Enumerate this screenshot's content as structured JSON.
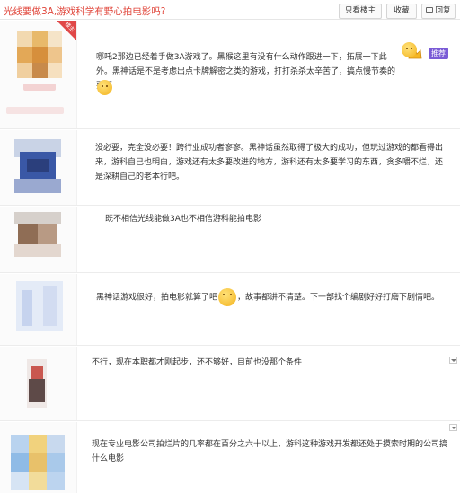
{
  "header": {
    "title": "光线要做3A,游戏科学有野心拍电影吗?",
    "buttons": {
      "only_op": "只看楼主",
      "favorite": "收藏",
      "reply": "回复"
    }
  },
  "badges": {
    "floor_tag": "楼主",
    "recommend": "推荐"
  },
  "posts": [
    {
      "text": "哪吒2那边已经着手做3A游戏了。黑猴这里有没有什么动作跟进一下，拓展一下此外。黑神话是不是考虑出点卡牌解密之类的游戏，打打杀杀太辛苦了，搞点慢节奏的耍耍"
    },
    {
      "text": "没必要，完全没必要！跨行业成功者寥寥。黑神话虽然取得了极大的成功，但玩过游戏的都看得出来，游科自己也明白，游戏还有太多要改进的地方，游科还有太多要学习的东西，贪多嚼不烂，还是深耕自己的老本行吧。"
    },
    {
      "text": "既不相信光线能做3A也不相信游科能拍电影"
    },
    {
      "text_a": "黑神话游戏很好，拍电影就算了吧",
      "text_b": "，故事都讲不清楚。下一部找个编剧好好打磨下剧情吧。"
    },
    {
      "text": "不行，现在本职都才刚起步，还不够好，目前也没那个条件"
    },
    {
      "text": "现在专业电影公司拍烂片的几率都在百分之六十以上，游科这种游戏开发都还处于摸索时期的公司搞什么电影"
    }
  ],
  "colors": {
    "title": "#e0453a",
    "floor_tag": "#e04848",
    "recommend": "#7a5bd6"
  }
}
